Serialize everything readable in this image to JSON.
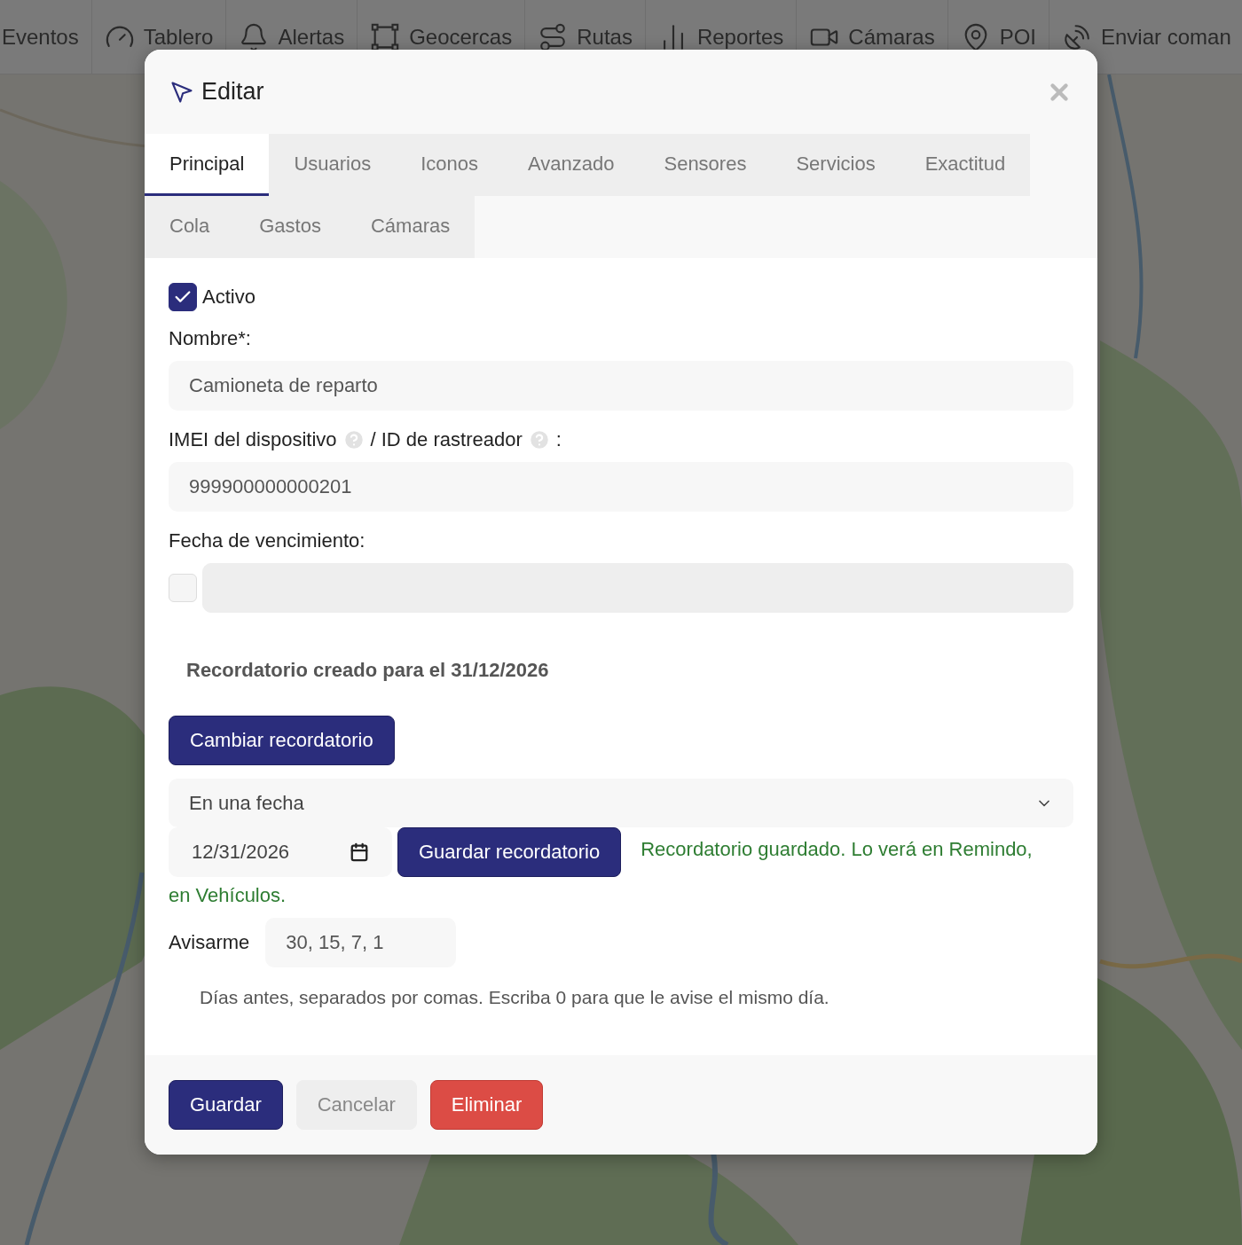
{
  "nav": {
    "items": [
      {
        "label": "Eventos"
      },
      {
        "label": "Tablero"
      },
      {
        "label": "Alertas"
      },
      {
        "label": "Geocercas"
      },
      {
        "label": "Rutas"
      },
      {
        "label": "Reportes"
      },
      {
        "label": "Cámaras"
      },
      {
        "label": "POI"
      },
      {
        "label": "Enviar coman"
      }
    ]
  },
  "modal": {
    "title": "Editar",
    "tab_rows": [
      [
        {
          "label": "Principal",
          "selected": true
        },
        {
          "label": "Usuarios",
          "selected": false
        },
        {
          "label": "Iconos",
          "selected": false
        },
        {
          "label": "Avanzado",
          "selected": false
        },
        {
          "label": "Sensores",
          "selected": false
        },
        {
          "label": "Servicios",
          "selected": false
        },
        {
          "label": "Exactitud",
          "selected": false
        }
      ],
      [
        {
          "label": "Cola",
          "selected": false
        },
        {
          "label": "Gastos",
          "selected": false
        },
        {
          "label": "Cámaras",
          "selected": false
        }
      ]
    ],
    "active": {
      "label": "Activo",
      "checked": true
    },
    "name": {
      "label": "Nombre*:",
      "value": "Camioneta de reparto"
    },
    "imei": {
      "label_parts": [
        "IMEI del dispositivo",
        "/ ID de rastreador",
        ":"
      ],
      "value": "999900000000201"
    },
    "expiry": {
      "label": "Fecha de vencimiento:",
      "checked": false,
      "disabled": true
    },
    "reminder_note": "Recordatorio creado para el 31/12/2026",
    "change_button": "Cambiar recordatorio",
    "mode_select": {
      "value": "En una fecha"
    },
    "date": {
      "value": "12/31/2026"
    },
    "save_reminder_button": "Guardar recordatorio",
    "saved_message_lines": [
      "Recordatorio guardado. Lo verá en Remindo,",
      "en Vehículos."
    ],
    "notify": {
      "label": "Avisarme",
      "value": "30, 15, 7, 1"
    },
    "help": "Días antes, separados por comas. Escriba 0 para que le avise el mismo día.",
    "footer_buttons": [
      {
        "label": "Guardar",
        "kind": "primary"
      },
      {
        "label": "Cancelar",
        "kind": "secondary"
      },
      {
        "label": "Eliminar",
        "kind": "danger"
      }
    ]
  }
}
